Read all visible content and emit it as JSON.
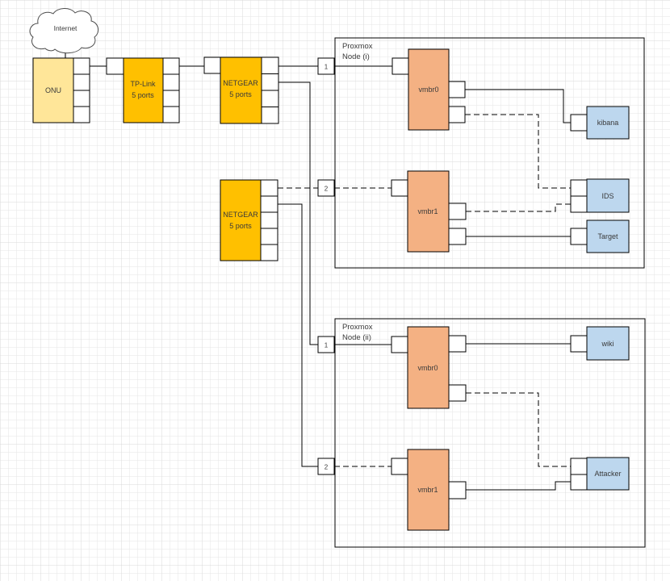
{
  "cloud": {
    "label": "Internet"
  },
  "devices": {
    "onu": {
      "label": "ONU"
    },
    "tplink": {
      "name": "TP-Link",
      "ports": "5 ports"
    },
    "netgear1": {
      "name": "NETGEAR",
      "ports": "5 ports"
    },
    "netgear2": {
      "name": "NETGEAR",
      "ports": "5 ports"
    }
  },
  "node1": {
    "title1": "Proxmox",
    "title2": "Node (i)",
    "uplink1": "1",
    "uplink2": "2",
    "vmbr0": "vmbr0",
    "vmbr1": "vmbr1",
    "vm_kibana": "kibana",
    "vm_ids": "IDS",
    "vm_target": "Target"
  },
  "node2": {
    "title1": "Proxmox",
    "title2": "Node (ii)",
    "uplink1": "1",
    "uplink2": "2",
    "vmbr0": "vmbr0",
    "vmbr1": "vmbr1",
    "vm_wiki": "wiki",
    "vm_attacker": "Attacker"
  },
  "colors": {
    "onu_fill": "#FFE699",
    "switch_fill": "#FFC000",
    "bridge_fill": "#F4B183",
    "vm_fill": "#BDD7EE",
    "cloud_stroke": "#4d4d4d",
    "line": "#000000",
    "text": "#3A3A3A",
    "grid_minor": "#E5E5E5",
    "grid_major": "#D9D9D9"
  }
}
